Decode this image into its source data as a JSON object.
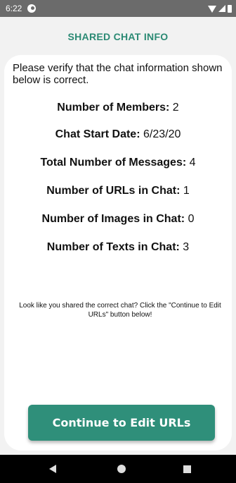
{
  "status_bar": {
    "time": "6:22",
    "icons": [
      "app-notification-icon",
      "wifi-icon",
      "signal-icon",
      "battery-icon"
    ]
  },
  "header": {
    "title": "SHARED CHAT INFO"
  },
  "intro": "Please verify that the chat information shown below is correct.",
  "stats": [
    {
      "label": "Number of Members:",
      "value": "2"
    },
    {
      "label": "Chat Start Date:",
      "value": "6/23/20"
    },
    {
      "label": "Total Number of Messages:",
      "value": "4"
    },
    {
      "label": "Number of URLs in Chat:",
      "value": "1"
    },
    {
      "label": "Number of Images in Chat:",
      "value": "0"
    },
    {
      "label": "Number of Texts in Chat:",
      "value": "3"
    }
  ],
  "note": "Look like you shared the correct chat? Click the \"Continue to Edit URLs\" button below!",
  "continue_button": {
    "label": "Continue to Edit URLs"
  },
  "colors": {
    "accent": "#2f8f7a",
    "title": "#2b8a74",
    "status_bar": "#6b6b6b",
    "background": "#f2f2f2"
  },
  "nav_bar": {
    "icons": [
      "back-icon",
      "home-icon",
      "recents-icon"
    ]
  }
}
